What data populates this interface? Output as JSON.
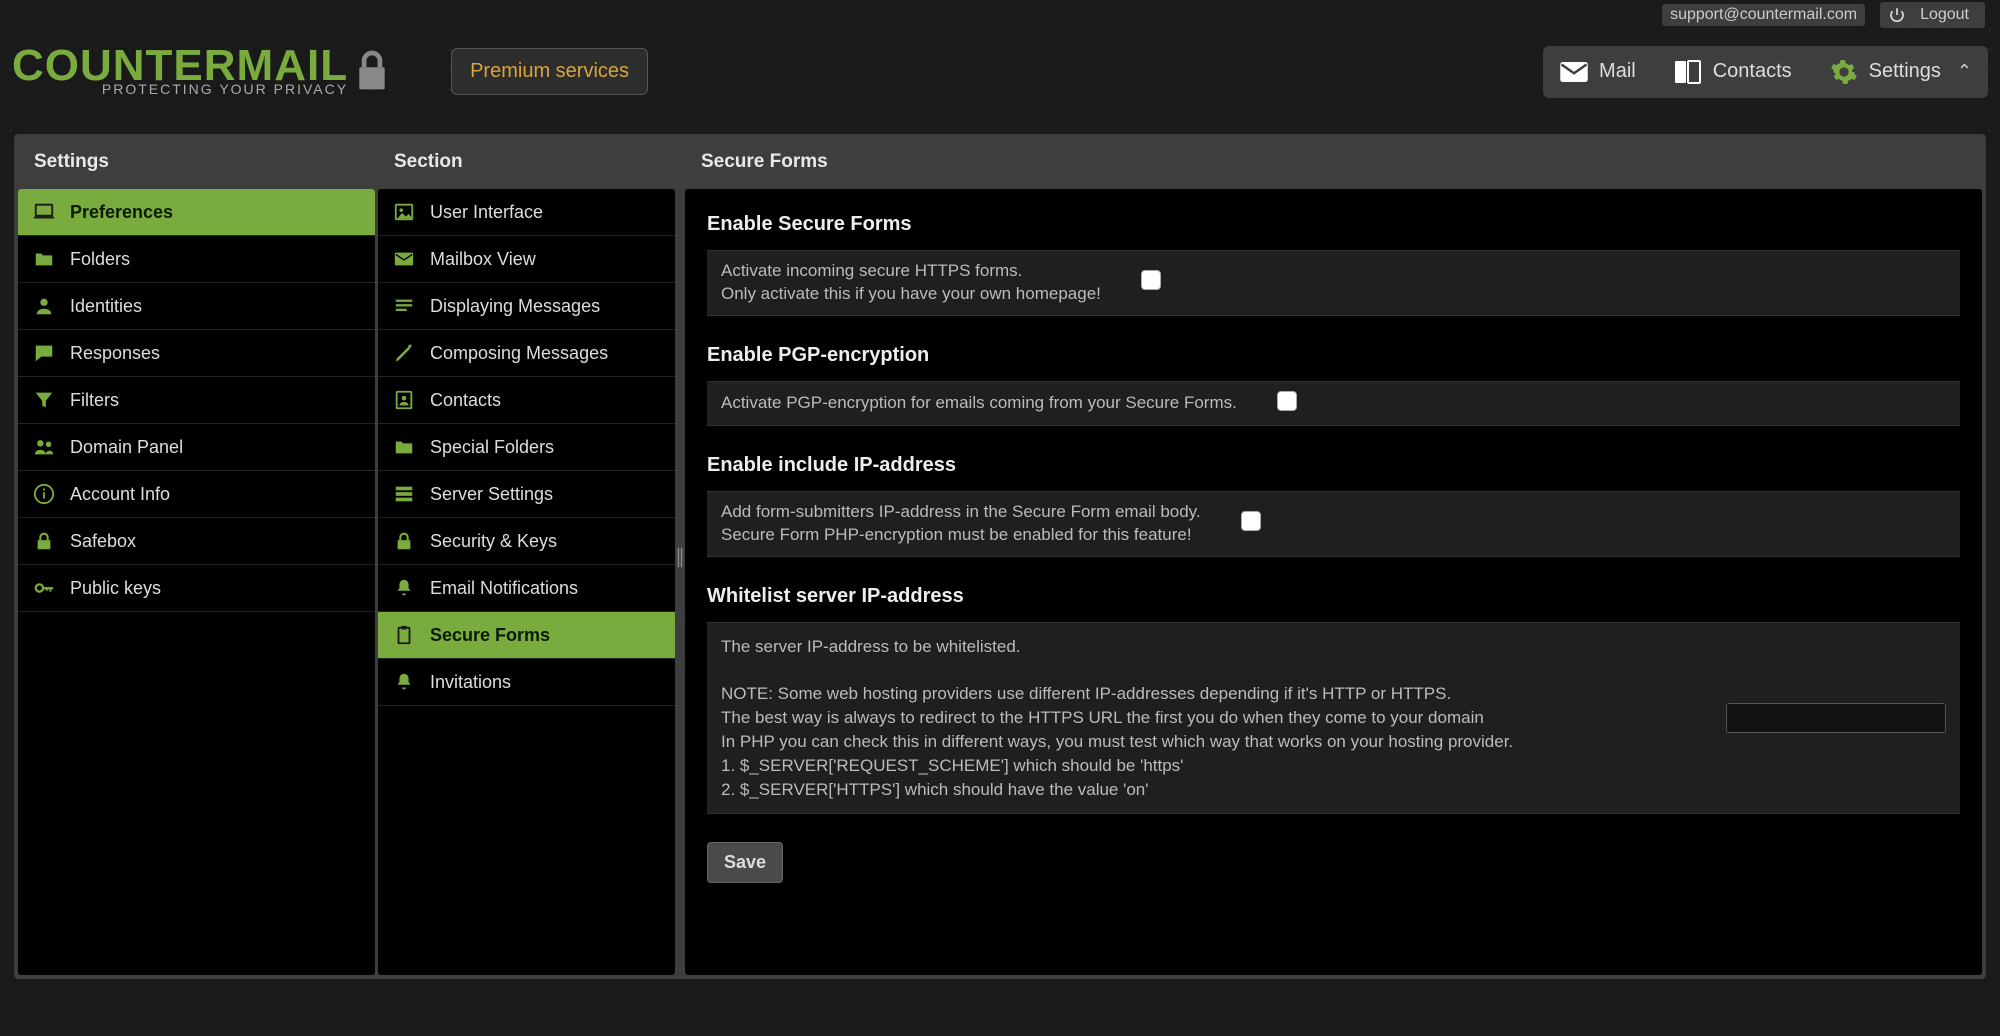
{
  "topbar": {
    "support": "support@countermail.com",
    "logout": "Logout"
  },
  "logo": {
    "main": "COUNTERMAIL",
    "sub": "PROTECTING YOUR PRIVACY"
  },
  "premium_label": "Premium services",
  "nav": {
    "mail": "Mail",
    "contacts": "Contacts",
    "settings": "Settings"
  },
  "columns": {
    "settings_title": "Settings",
    "section_title": "Section",
    "content_title": "Secure Forms"
  },
  "settings_list": [
    {
      "label": "Preferences",
      "icon": "laptop",
      "active": true
    },
    {
      "label": "Folders",
      "icon": "folder"
    },
    {
      "label": "Identities",
      "icon": "person"
    },
    {
      "label": "Responses",
      "icon": "chat"
    },
    {
      "label": "Filters",
      "icon": "filter"
    },
    {
      "label": "Domain Panel",
      "icon": "people"
    },
    {
      "label": "Account Info",
      "icon": "info"
    },
    {
      "label": "Safebox",
      "icon": "lock"
    },
    {
      "label": "Public keys",
      "icon": "key"
    }
  ],
  "section_list": [
    {
      "label": "User Interface",
      "icon": "image"
    },
    {
      "label": "Mailbox View",
      "icon": "mail"
    },
    {
      "label": "Displaying Messages",
      "icon": "lines"
    },
    {
      "label": "Composing Messages",
      "icon": "pencil"
    },
    {
      "label": "Contacts",
      "icon": "contact"
    },
    {
      "label": "Special Folders",
      "icon": "folder"
    },
    {
      "label": "Server Settings",
      "icon": "server"
    },
    {
      "label": "Security & Keys",
      "icon": "lock"
    },
    {
      "label": "Email Notifications",
      "icon": "bell"
    },
    {
      "label": "Secure Forms",
      "icon": "clipboard",
      "active": true
    },
    {
      "label": "Invitations",
      "icon": "bell"
    }
  ],
  "form": {
    "secure_forms": {
      "legend": "Enable Secure Forms",
      "label": "Activate incoming secure HTTPS forms.\nOnly activate this if you have your own homepage!"
    },
    "pgp": {
      "legend": "Enable PGP-encryption",
      "label": "Activate PGP-encryption for emails coming from your Secure Forms."
    },
    "ip": {
      "legend": "Enable include IP-address",
      "label": "Add form-submitters IP-address in the Secure Form email body.\nSecure Form PHP-encryption must be enabled for this feature!"
    },
    "whitelist": {
      "legend": "Whitelist server IP-address",
      "text": "The server IP-address to be whitelisted.\n\nNOTE: Some web hosting providers use different IP-addresses depending if it's HTTP or HTTPS.\nThe best way is always to redirect to the HTTPS URL the first you do when they come to your domain\nIn PHP you can check this in different ways, you must test which way that works on your hosting provider.\n1. $_SERVER['REQUEST_SCHEME'] which should be 'https'\n2. $_SERVER['HTTPS'] which should have the value 'on'"
    },
    "save": "Save"
  }
}
